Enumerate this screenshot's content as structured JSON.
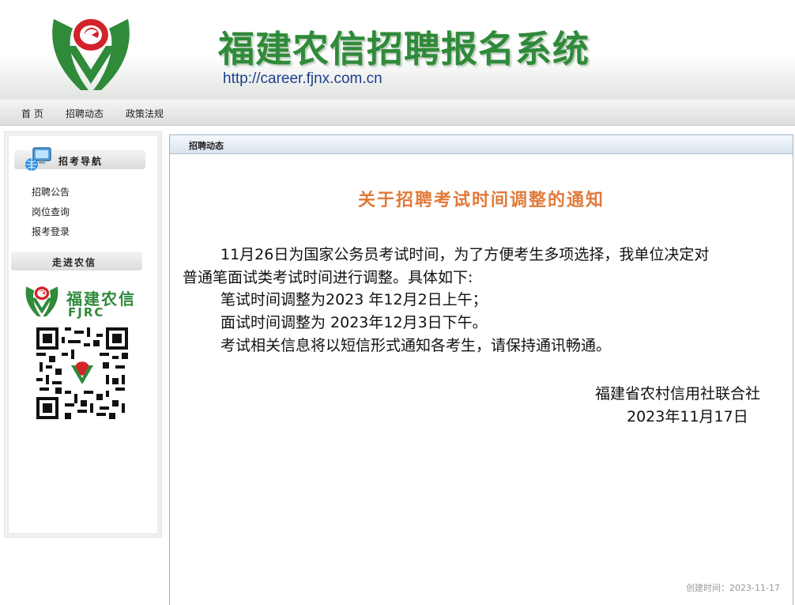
{
  "header": {
    "title": "福建农信招聘报名系统",
    "url": "http://career.fjnx.com.cn",
    "brand_color": "#2f8a3a",
    "logo_icon": "fjnx-logo-icon"
  },
  "nav": {
    "items": [
      {
        "label": "首 页"
      },
      {
        "label": "招聘动态"
      },
      {
        "label": "政策法规"
      }
    ]
  },
  "sidebar": {
    "guide_title": "招考导航",
    "guide_icon": "computer-globe-icon",
    "links": [
      {
        "label": "招聘公告"
      },
      {
        "label": "岗位查询"
      },
      {
        "label": "报考登录"
      }
    ],
    "about_title": "走进农信",
    "brand_name_cn": "福建农信",
    "brand_name_en": "FJRC",
    "qr_icon": "qr-code-icon"
  },
  "main": {
    "section_title": "招聘动态",
    "notice": {
      "title": "关于招聘考试时间调整的通知",
      "title_color": "#e07a3a",
      "lines": [
        "11月26日为国家公务员考试时间，为了方便考生多项选择，我单位决定对",
        "普通笔面试类考试时间进行调整。具体如下:",
        "笔试时间调整为2023 年12月2日上午；",
        "面试时间调整为 2023年12月3日下午。",
        "考试相关信息将以短信形式通知各考生，请保持通讯畅通。"
      ],
      "signature_org": "福建省农村信用社联合社",
      "signature_date": "2023年11月17日"
    },
    "created_at": "创建时间：2023-11-17"
  }
}
